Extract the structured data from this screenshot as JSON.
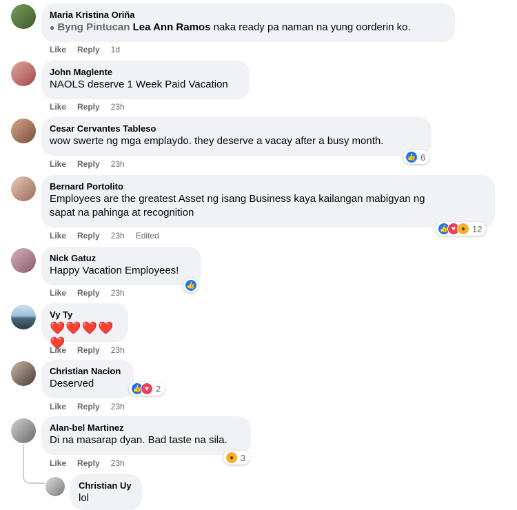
{
  "comments": [
    {
      "name": "Maria Kristina Oriña",
      "mention_icon": "●",
      "mention1": "Byng Pintucan",
      "mention2": "Lea Ann Ramos",
      "text": " naka ready pa naman na yung oorderin ko.",
      "like": "Like",
      "reply": "Reply",
      "time": "1d"
    },
    {
      "name": "John Maglente",
      "text": "NAOLS deserve 1 Week Paid Vacation",
      "like": "Like",
      "reply": "Reply",
      "time": "23h"
    },
    {
      "name": "Cesar Cervantes Tableso",
      "text": "wow swerte ng mga emplaydo. they deserve a vacay after a busy month.",
      "like": "Like",
      "reply": "Reply",
      "time": "23h",
      "reaction_count": "6"
    },
    {
      "name": "Bernard Portolito",
      "text_line1": "Employees are the greatest Asset ng isang Business kaya kailangan mabigyan ng",
      "text_line2": "sapat na pahinga at recognition",
      "like": "Like",
      "reply": "Reply",
      "time": "23h",
      "edited": "Edited",
      "reaction_count": "12"
    },
    {
      "name": "Nick Gatuz",
      "text": "Happy Vacation Employees!",
      "like": "Like",
      "reply": "Reply",
      "time": "23h"
    },
    {
      "name": "Vy Ty",
      "text": "❤️❤️❤️❤️❤️",
      "like": "Like",
      "reply": "Reply",
      "time": "23h"
    },
    {
      "name": "Christian Nacion",
      "text": "Deserved",
      "like": "Like",
      "reply": "Reply",
      "time": "23h",
      "reaction_count": "2"
    },
    {
      "name": "Alan-bel Martinez",
      "text": "Di na masarap dyan. Bad taste na sila.",
      "like": "Like",
      "reply": "Reply",
      "time": "23h",
      "reaction_count": "3"
    }
  ],
  "reply": {
    "name": "Christian Uy",
    "text": "lol"
  },
  "colors": {
    "bubble": "#f0f2f5",
    "meta": "#65676b",
    "like": "#1877f2",
    "love": "#f33e58",
    "wow": "#f7b125"
  }
}
